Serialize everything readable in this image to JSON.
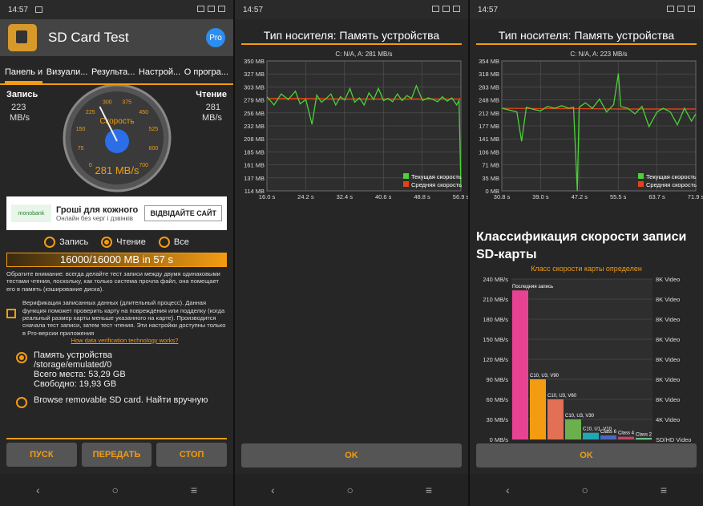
{
  "status": {
    "time": "14:57"
  },
  "app": {
    "title": "SD Card Test",
    "pro": "Pro"
  },
  "tabs": [
    "Панель и",
    "Визуали...",
    "Результа...",
    "Настрой...",
    "О програ..."
  ],
  "gauge": {
    "write_label": "Запись",
    "write_value": "223",
    "write_unit": "MB/s",
    "read_label": "Чтение",
    "read_value": "281",
    "read_unit": "MB/s",
    "title": "Скорость",
    "value_text": "281 MB/s",
    "value": 281,
    "max": 700,
    "ticks": [
      "0",
      "75",
      "150",
      "225",
      "300",
      "375",
      "450",
      "525",
      "600",
      "700"
    ]
  },
  "ad": {
    "logo": "monobank",
    "title": "Гроші для кожного украї",
    "subtitle": "Онлайн без черг і дзвінків",
    "button": "ВІДВІДАЙТЕ САЙТ"
  },
  "mode": {
    "write": "Запись",
    "read": "Чтение",
    "all": "Все",
    "selected": "read"
  },
  "progress": {
    "text": "16000/16000 MB in 57 s",
    "fraction": 1.0
  },
  "note": "Обратите внимание: всегда делайте тест записи между двумя одинаковыми тестами чтения, поскольку, как только система прочла файл, она помещает его в память (кэширование диска).",
  "verify": {
    "text": "Верификация записанных данных (длительный процесс). Данная функция поможет проверить карту на повреждения или подделку (когда реальный размер карты меньше указанного на карте). Производится сначала тест записи, затем тест чтения. Эти настройки доступны только в Pro-версии приложения",
    "link": "How data verification technology works?"
  },
  "storage": {
    "name": "Память устройства",
    "path": "/storage/emulated/0",
    "total": "Всего места: 53,29 GB",
    "free": "Свободно: 19,93 GB",
    "browse": "Browse removable SD card. Найти вручную"
  },
  "buttons": {
    "start": "ПУСК",
    "share": "ПЕРЕДАТЬ",
    "stop": "СТОП",
    "ok": "OK"
  },
  "chart_data": [
    {
      "type": "line",
      "title": "Тип носителя: Память устройства",
      "subtitle": "C: N/A, A: 281 MB/s",
      "y_ticks": [
        "350 MB",
        "327 MB",
        "303 MB",
        "279 MB",
        "256 MB",
        "232 MB",
        "208 MB",
        "185 MB",
        "161 MB",
        "137 MB",
        "114 MB"
      ],
      "x_ticks": [
        "16.0 s",
        "24.2 s",
        "32.4 s",
        "40.6 s",
        "48.8 s",
        "56.9 s"
      ],
      "ylim": [
        114,
        350
      ],
      "xlim": [
        16.0,
        56.9
      ],
      "series": [
        {
          "name": "Текущая скорость",
          "color": "#4cd137",
          "x": [
            16.0,
            17.5,
            19.0,
            20.5,
            22.0,
            23.0,
            24.2,
            25.5,
            26.5,
            27.5,
            28.5,
            29.5,
            30.5,
            31.5,
            32.4,
            33.5,
            34.5,
            35.5,
            36.5,
            37.5,
            38.5,
            39.5,
            40.6,
            41.5,
            42.5,
            43.5,
            44.5,
            45.5,
            46.5,
            47.5,
            48.8,
            50.0,
            51.0,
            52.0,
            53.0,
            54.0,
            55.0,
            56.0,
            56.5,
            56.9
          ],
          "y": [
            285,
            270,
            290,
            280,
            295,
            272,
            280,
            235,
            288,
            275,
            282,
            290,
            270,
            285,
            279,
            300,
            275,
            283,
            270,
            292,
            280,
            300,
            278,
            282,
            276,
            290,
            278,
            287,
            282,
            305,
            278,
            283,
            280,
            276,
            285,
            277,
            283,
            270,
            278,
            120
          ]
        },
        {
          "name": "Средняя скорость",
          "color": "#e84118",
          "x": [
            16.0,
            24.2,
            32.4,
            40.6,
            48.8,
            56.9
          ],
          "y": [
            282,
            282,
            281,
            281,
            281,
            281
          ]
        }
      ]
    },
    {
      "type": "line",
      "title": "Тип носителя: Память устройства",
      "subtitle": "C: N/A, A: 223 MB/s",
      "y_ticks": [
        "354 MB",
        "318 MB",
        "283 MB",
        "248 MB",
        "212 MB",
        "177 MB",
        "141 MB",
        "106 MB",
        "71 MB",
        "35 MB",
        "0 MB"
      ],
      "x_ticks": [
        "30.8 s",
        "39.0 s",
        "47.2 s",
        "55.5 s",
        "63.7 s",
        "71.9 s"
      ],
      "ylim": [
        0,
        354
      ],
      "xlim": [
        30.8,
        71.9
      ],
      "series": [
        {
          "name": "Текущая скорость",
          "color": "#4cd137",
          "x": [
            30.8,
            32.5,
            34.0,
            35.0,
            36.0,
            37.5,
            39.0,
            40.5,
            42.0,
            43.5,
            45.0,
            46.0,
            46.8,
            47.2,
            48.5,
            50.0,
            51.5,
            53.0,
            54.5,
            55.5,
            56.0,
            57.5,
            59.0,
            60.5,
            62.0,
            63.7,
            65.0,
            66.5,
            68.0,
            69.5,
            71.0,
            71.9
          ],
          "y": [
            225,
            220,
            215,
            135,
            228,
            222,
            218,
            230,
            225,
            232,
            225,
            228,
            0,
            228,
            240,
            225,
            250,
            215,
            235,
            320,
            230,
            225,
            210,
            230,
            175,
            215,
            225,
            215,
            180,
            225,
            190,
            210
          ]
        },
        {
          "name": "Средняя скорость",
          "color": "#e84118",
          "x": [
            30.8,
            39.0,
            47.2,
            55.5,
            63.7,
            71.9
          ],
          "y": [
            225,
            224,
            224,
            223,
            223,
            223
          ]
        }
      ]
    },
    {
      "type": "bar",
      "title": "Классификация скорости записи SD-карты",
      "subtitle": "Класс скорости карты определен",
      "y_ticks": [
        "240 MB/s",
        "210 MB/s",
        "180 MB/s",
        "150 MB/s",
        "120 MB/s",
        "90 MB/s",
        "60 MB/s",
        "30 MB/s",
        "0 MB/s"
      ],
      "right_ticks": [
        "8K Video",
        "8K Video",
        "8K Video",
        "8K Video",
        "8K Video",
        "8K Video",
        "8K Video",
        "4K Video",
        "SD/HD Video"
      ],
      "ylim": [
        0,
        240
      ],
      "categories": [
        "Последняя запись",
        "C10, U3, V90",
        "C10, U3, V60",
        "C10, U3, V30",
        "C10, U1, V10",
        "Class 6",
        "Class 4",
        "Class 2"
      ],
      "values": [
        223,
        90,
        60,
        30,
        10,
        6,
        4,
        2
      ],
      "colors": [
        "#e84393",
        "#f39c12",
        "#e17055",
        "#6ab04c",
        "#22a6b3",
        "#4a69bd",
        "#c44569",
        "#7bed9f"
      ]
    }
  ]
}
